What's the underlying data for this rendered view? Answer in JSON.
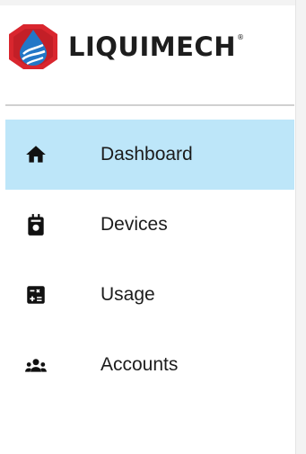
{
  "brand": {
    "name": "LIQUIMECH",
    "registered_mark": "®",
    "logo_icon": "liquimech-drop-logo-icon",
    "colors": {
      "red": "#d9262e",
      "blue": "#2277c7",
      "text": "#1d1d1d"
    }
  },
  "nav": {
    "items": [
      {
        "label": "Dashboard",
        "icon": "home-icon",
        "active": true
      },
      {
        "label": "Devices",
        "icon": "device-icon",
        "active": false
      },
      {
        "label": "Usage",
        "icon": "calculator-icon",
        "active": false
      },
      {
        "label": "Accounts",
        "icon": "people-icon",
        "active": false
      }
    ],
    "active_color": "#bde6f9"
  }
}
